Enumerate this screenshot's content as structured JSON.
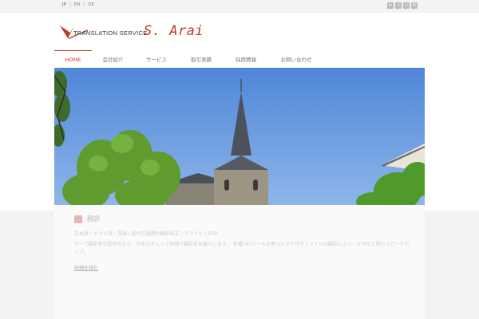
{
  "topbar": {
    "languages": [
      {
        "label": "JP",
        "active": true
      },
      {
        "label": "EN",
        "active": false
      },
      {
        "label": "DE",
        "active": false
      }
    ],
    "separator": "/",
    "social_icons": [
      "linkedin-icon",
      "share-icon",
      "rss-icon",
      "mail-icon"
    ],
    "social_glyphs": [
      "in",
      "<",
      "▫",
      "✉"
    ]
  },
  "logo": {
    "small_text": "TRANSLATION SERVICE",
    "big_text": "S. Arai"
  },
  "nav": {
    "items": [
      {
        "label": "HOME",
        "active": true
      },
      {
        "label": "会社紹介",
        "active": false
      },
      {
        "label": "サービス",
        "active": false
      },
      {
        "label": "取引実績",
        "active": false
      },
      {
        "label": "採用情報",
        "active": false
      },
      {
        "label": "お問い合わせ",
        "active": false
      }
    ]
  },
  "section": {
    "title": "翻訳",
    "tags": "日本語・ドイツ語・英語  /  欧州言語間の翻訳校正  /  リライト  /  DTP",
    "description": "チーフ翻訳者の監修のもと、万全のチェック体制で翻訳をお届けします。 各種CATツールを使ったタグ付きファイルの翻訳により、DTPの工程もスピードアップ。",
    "more_link": "詳細を読む"
  },
  "colors": {
    "accent": "#c0392b",
    "sky": "#5f93de",
    "background": "#f3f3f3"
  }
}
